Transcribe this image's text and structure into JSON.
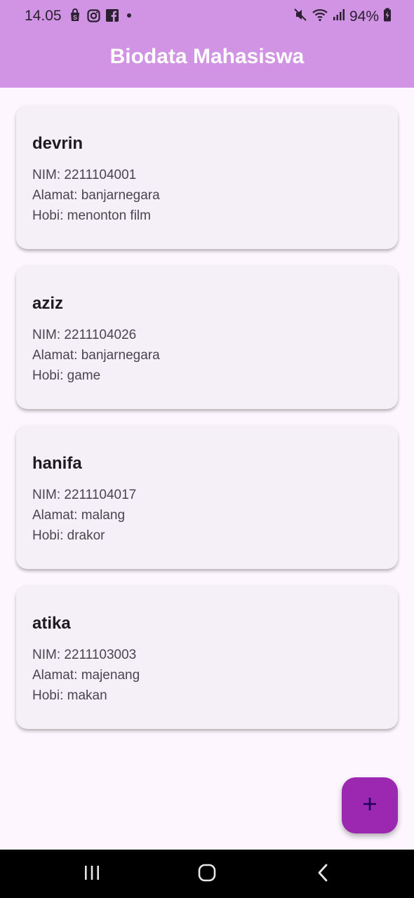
{
  "status_bar": {
    "time": "14.05",
    "battery": "94%"
  },
  "app_bar": {
    "title": "Biodata Mahasiswa"
  },
  "students": [
    {
      "name": "devrin",
      "nim": "NIM: 2211104001",
      "alamat": "Alamat: banjarnegara",
      "hobi": "Hobi: menonton film"
    },
    {
      "name": "aziz",
      "nim": "NIM: 2211104026",
      "alamat": "Alamat: banjarnegara",
      "hobi": "Hobi: game"
    },
    {
      "name": "hanifa",
      "nim": "NIM: 2211104017",
      "alamat": "Alamat: malang",
      "hobi": "Hobi: drakor"
    },
    {
      "name": "atika",
      "nim": "NIM: 2211103003",
      "alamat": "Alamat: majenang",
      "hobi": "Hobi: makan"
    }
  ],
  "fab": {
    "icon": "plus-icon"
  },
  "nav_bar": {
    "icons": [
      "recent-apps-icon",
      "home-icon",
      "back-icon"
    ]
  },
  "colors": {
    "app_bar": "#d193e3",
    "background": "#fdf6fe",
    "card": "#f5eff8",
    "fab": "#9c27b0"
  }
}
